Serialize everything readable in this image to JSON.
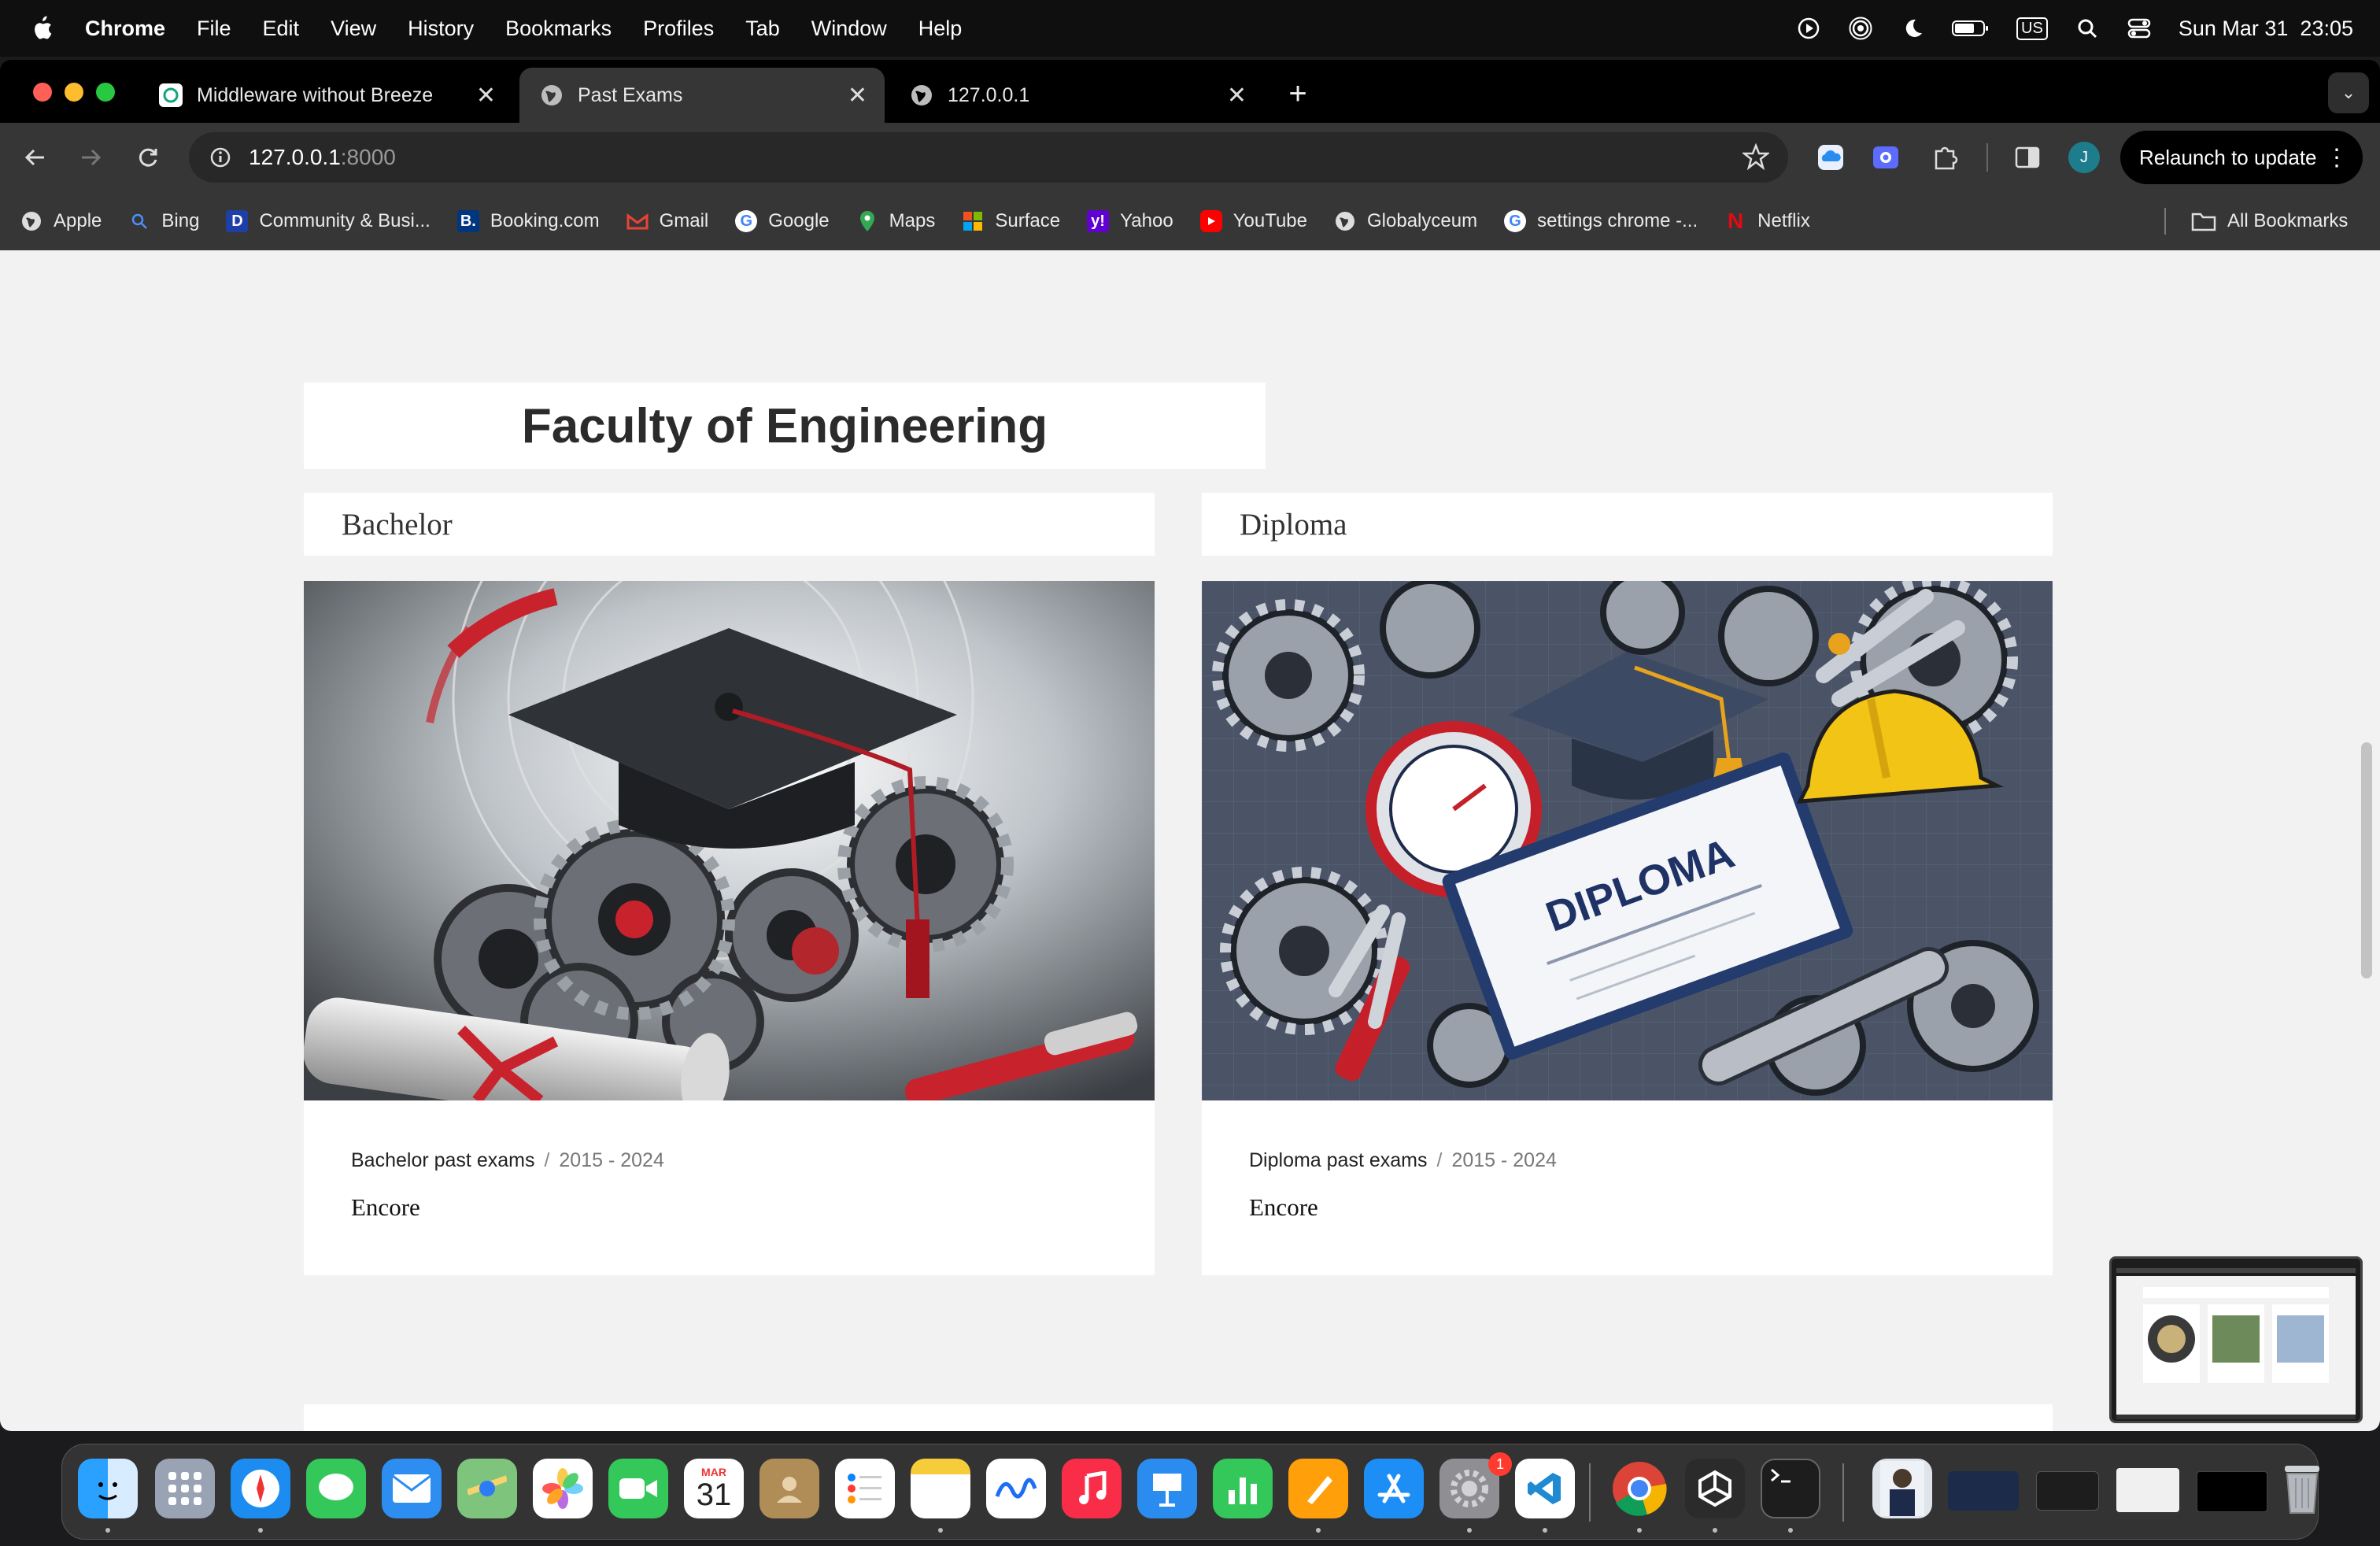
{
  "menubar": {
    "app": "Chrome",
    "items": [
      "File",
      "Edit",
      "View",
      "History",
      "Bookmarks",
      "Profiles",
      "Tab",
      "Window",
      "Help"
    ],
    "keyboard": "US",
    "datetime": "Sun Mar 31  23:05"
  },
  "tabs": [
    {
      "title": "Middleware without Breeze",
      "icon": "chatgpt-icon",
      "active": false
    },
    {
      "title": "Past Exams",
      "icon": "globe-icon",
      "active": true
    },
    {
      "title": "127.0.0.1",
      "icon": "globe-icon",
      "active": false
    }
  ],
  "omnibox": {
    "host": "127.0.0.1",
    "port": ":8000"
  },
  "relaunch_label": "Relaunch to update",
  "avatar_initial": "J",
  "bookmarks": [
    {
      "label": "Apple",
      "icon": "globe-icon"
    },
    {
      "label": "Bing",
      "icon": "search-icon"
    },
    {
      "label": "Community & Busi...",
      "icon": "brand-icon"
    },
    {
      "label": "Booking.com",
      "icon": "booking-icon"
    },
    {
      "label": "Gmail",
      "icon": "gmail-icon"
    },
    {
      "label": "Google",
      "icon": "google-icon"
    },
    {
      "label": "Maps",
      "icon": "maps-icon"
    },
    {
      "label": "Surface",
      "icon": "windows-icon"
    },
    {
      "label": "Yahoo",
      "icon": "yahoo-icon"
    },
    {
      "label": "YouTube",
      "icon": "youtube-icon"
    },
    {
      "label": "Globalyceum",
      "icon": "globe-icon"
    },
    {
      "label": "settings chrome -...",
      "icon": "google-icon"
    },
    {
      "label": "Netflix",
      "icon": "netflix-icon"
    }
  ],
  "all_bookmarks": "All Bookmarks",
  "page": {
    "title": "Faculty of Engineering",
    "cards": [
      {
        "heading": "Bachelor",
        "link": "Bachelor past exams",
        "separator": "/",
        "years": "2015 - 2024",
        "subtitle": "Encore"
      },
      {
        "heading": "Diploma",
        "link": "Diploma past exams",
        "separator": "/",
        "years": "2015 - 2024",
        "subtitle": "Encore"
      }
    ]
  },
  "dock": {
    "calendar_month": "MAR",
    "calendar_day": "31",
    "settings_badge": "1"
  },
  "colors": {
    "page_bg": "#f2f2f2",
    "tab_active": "#363636",
    "toolbar": "#363636"
  }
}
